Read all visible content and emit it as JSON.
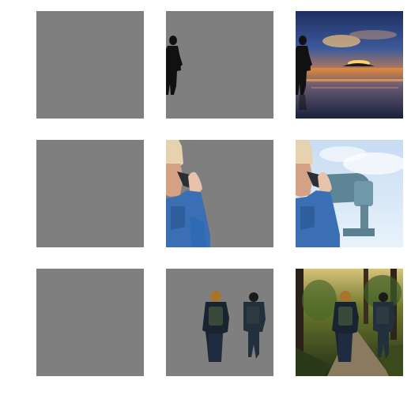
{
  "colors": {
    "background": "#ffffff",
    "mask_gray": "#7f7f7f"
  },
  "grid": {
    "rows": [
      {
        "subject": "person-at-sunset-beach",
        "cells": [
          {
            "kind": "blank-gray-tile"
          },
          {
            "kind": "segmented-cutout-on-gray",
            "content": "silhouette-person"
          },
          {
            "kind": "original-photo",
            "content": "sunset-beach-with-silhouette"
          }
        ]
      },
      {
        "subject": "person-with-tower-viewer",
        "cells": [
          {
            "kind": "blank-gray-tile"
          },
          {
            "kind": "segmented-cutout-on-gray",
            "content": "person-in-denim-jacket"
          },
          {
            "kind": "original-photo",
            "content": "person-using-coin-binoculars"
          }
        ]
      },
      {
        "subject": "two-hikers-forest-trail",
        "cells": [
          {
            "kind": "blank-gray-tile"
          },
          {
            "kind": "segmented-cutout-on-gray",
            "content": "two-hikers-with-backpacks"
          },
          {
            "kind": "original-photo",
            "content": "forest-trail-with-hikers"
          }
        ]
      }
    ]
  }
}
